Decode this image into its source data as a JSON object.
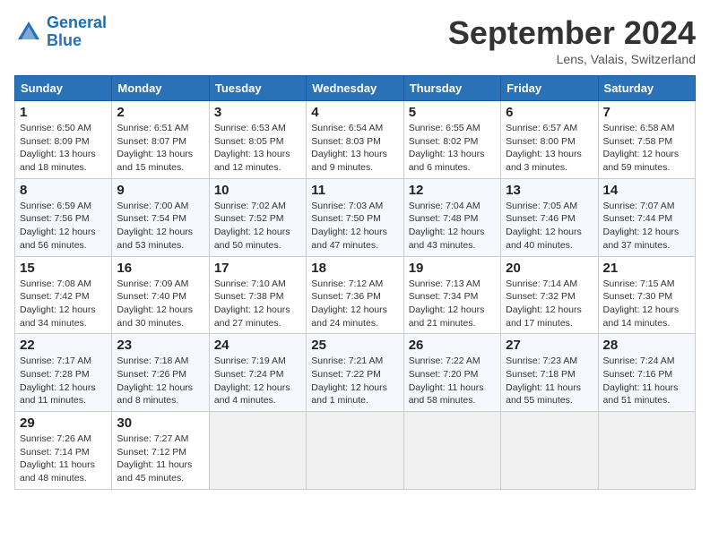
{
  "logo": {
    "line1": "General",
    "line2": "Blue"
  },
  "title": "September 2024",
  "subtitle": "Lens, Valais, Switzerland",
  "days_of_week": [
    "Sunday",
    "Monday",
    "Tuesday",
    "Wednesday",
    "Thursday",
    "Friday",
    "Saturday"
  ],
  "weeks": [
    [
      {
        "day": "1",
        "info": "Sunrise: 6:50 AM\nSunset: 8:09 PM\nDaylight: 13 hours\nand 18 minutes."
      },
      {
        "day": "2",
        "info": "Sunrise: 6:51 AM\nSunset: 8:07 PM\nDaylight: 13 hours\nand 15 minutes."
      },
      {
        "day": "3",
        "info": "Sunrise: 6:53 AM\nSunset: 8:05 PM\nDaylight: 13 hours\nand 12 minutes."
      },
      {
        "day": "4",
        "info": "Sunrise: 6:54 AM\nSunset: 8:03 PM\nDaylight: 13 hours\nand 9 minutes."
      },
      {
        "day": "5",
        "info": "Sunrise: 6:55 AM\nSunset: 8:02 PM\nDaylight: 13 hours\nand 6 minutes."
      },
      {
        "day": "6",
        "info": "Sunrise: 6:57 AM\nSunset: 8:00 PM\nDaylight: 13 hours\nand 3 minutes."
      },
      {
        "day": "7",
        "info": "Sunrise: 6:58 AM\nSunset: 7:58 PM\nDaylight: 12 hours\nand 59 minutes."
      }
    ],
    [
      {
        "day": "8",
        "info": "Sunrise: 6:59 AM\nSunset: 7:56 PM\nDaylight: 12 hours\nand 56 minutes."
      },
      {
        "day": "9",
        "info": "Sunrise: 7:00 AM\nSunset: 7:54 PM\nDaylight: 12 hours\nand 53 minutes."
      },
      {
        "day": "10",
        "info": "Sunrise: 7:02 AM\nSunset: 7:52 PM\nDaylight: 12 hours\nand 50 minutes."
      },
      {
        "day": "11",
        "info": "Sunrise: 7:03 AM\nSunset: 7:50 PM\nDaylight: 12 hours\nand 47 minutes."
      },
      {
        "day": "12",
        "info": "Sunrise: 7:04 AM\nSunset: 7:48 PM\nDaylight: 12 hours\nand 43 minutes."
      },
      {
        "day": "13",
        "info": "Sunrise: 7:05 AM\nSunset: 7:46 PM\nDaylight: 12 hours\nand 40 minutes."
      },
      {
        "day": "14",
        "info": "Sunrise: 7:07 AM\nSunset: 7:44 PM\nDaylight: 12 hours\nand 37 minutes."
      }
    ],
    [
      {
        "day": "15",
        "info": "Sunrise: 7:08 AM\nSunset: 7:42 PM\nDaylight: 12 hours\nand 34 minutes."
      },
      {
        "day": "16",
        "info": "Sunrise: 7:09 AM\nSunset: 7:40 PM\nDaylight: 12 hours\nand 30 minutes."
      },
      {
        "day": "17",
        "info": "Sunrise: 7:10 AM\nSunset: 7:38 PM\nDaylight: 12 hours\nand 27 minutes."
      },
      {
        "day": "18",
        "info": "Sunrise: 7:12 AM\nSunset: 7:36 PM\nDaylight: 12 hours\nand 24 minutes."
      },
      {
        "day": "19",
        "info": "Sunrise: 7:13 AM\nSunset: 7:34 PM\nDaylight: 12 hours\nand 21 minutes."
      },
      {
        "day": "20",
        "info": "Sunrise: 7:14 AM\nSunset: 7:32 PM\nDaylight: 12 hours\nand 17 minutes."
      },
      {
        "day": "21",
        "info": "Sunrise: 7:15 AM\nSunset: 7:30 PM\nDaylight: 12 hours\nand 14 minutes."
      }
    ],
    [
      {
        "day": "22",
        "info": "Sunrise: 7:17 AM\nSunset: 7:28 PM\nDaylight: 12 hours\nand 11 minutes."
      },
      {
        "day": "23",
        "info": "Sunrise: 7:18 AM\nSunset: 7:26 PM\nDaylight: 12 hours\nand 8 minutes."
      },
      {
        "day": "24",
        "info": "Sunrise: 7:19 AM\nSunset: 7:24 PM\nDaylight: 12 hours\nand 4 minutes."
      },
      {
        "day": "25",
        "info": "Sunrise: 7:21 AM\nSunset: 7:22 PM\nDaylight: 12 hours\nand 1 minute."
      },
      {
        "day": "26",
        "info": "Sunrise: 7:22 AM\nSunset: 7:20 PM\nDaylight: 11 hours\nand 58 minutes."
      },
      {
        "day": "27",
        "info": "Sunrise: 7:23 AM\nSunset: 7:18 PM\nDaylight: 11 hours\nand 55 minutes."
      },
      {
        "day": "28",
        "info": "Sunrise: 7:24 AM\nSunset: 7:16 PM\nDaylight: 11 hours\nand 51 minutes."
      }
    ],
    [
      {
        "day": "29",
        "info": "Sunrise: 7:26 AM\nSunset: 7:14 PM\nDaylight: 11 hours\nand 48 minutes."
      },
      {
        "day": "30",
        "info": "Sunrise: 7:27 AM\nSunset: 7:12 PM\nDaylight: 11 hours\nand 45 minutes."
      },
      null,
      null,
      null,
      null,
      null
    ]
  ]
}
